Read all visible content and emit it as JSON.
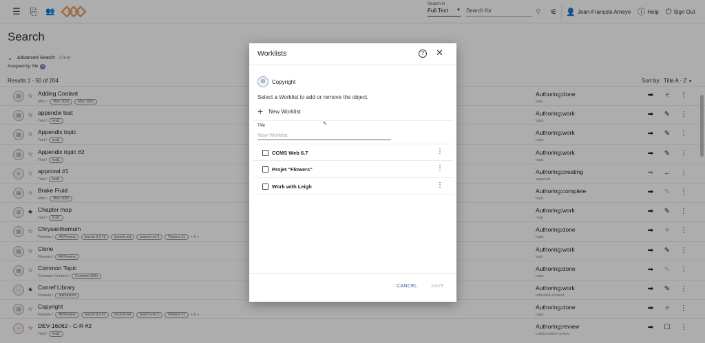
{
  "topbar": {
    "search_in_label": "Search in",
    "search_in_value": "Full Text",
    "search_placeholder": "Search for",
    "user_name": "Jean-François Ameye",
    "help_label": "Help",
    "signout_label": "Sign Out"
  },
  "page": {
    "title": "Search",
    "advanced_search": "Advanced Search",
    "clear": "Clear",
    "assigned_chip": "Assigned by: Me",
    "results": "Results 1 - 50 of 204",
    "sort_by": "Sort by:",
    "sort_value": "Title A - Z"
  },
  "rows": [
    {
      "title": "Adding Coolant",
      "sub": "Misc /",
      "tags": [
        "Misc 2019",
        "Misc 2020"
      ],
      "status": "Authoring:done",
      "type": "task",
      "a1": "➡",
      "a2": "⑂",
      "a1grey": false,
      "a2grey": false,
      "icon": "▤",
      "starred": false
    },
    {
      "title": "appendix test",
      "sub": "Test /",
      "tags": [
        "test1"
      ],
      "status": "Authoring:work",
      "type": "topic",
      "a1": "➡",
      "a2": "✎",
      "a1grey": false,
      "a2grey": false,
      "icon": "▤",
      "starred": false
    },
    {
      "title": "Appendix topic",
      "sub": "Test /",
      "tags": [
        "test1"
      ],
      "status": "Authoring:work",
      "type": "topic",
      "a1": "➡",
      "a2": "✎",
      "a1grey": false,
      "a2grey": false,
      "icon": "▤",
      "starred": false
    },
    {
      "title": "Appendix topic #2",
      "sub": "Test /",
      "tags": [
        "test1"
      ],
      "status": "Authoring:work",
      "type": "topic",
      "a1": "➡",
      "a2": "✎",
      "a1grey": false,
      "a2grey": false,
      "icon": "▤",
      "starred": false
    },
    {
      "title": "approval #1",
      "sub": "Test /",
      "tags": [
        "test1"
      ],
      "status": "Authoring:creating",
      "type": "approval",
      "a1": "➡",
      "a2": "←",
      "a1grey": true,
      "a2grey": false,
      "icon": "♕",
      "starred": false
    },
    {
      "title": "Brake Fluid",
      "sub": "Misc /",
      "tags": [
        "Misc 2020"
      ],
      "status": "Authoring:complete",
      "type": "topic",
      "a1": "➡",
      "a2": "✎",
      "a1grey": false,
      "a2grey": true,
      "icon": "▤",
      "starred": false
    },
    {
      "title": "Chapter map",
      "sub": "Test /",
      "tags": [
        "test1"
      ],
      "status": "Authoring:work",
      "type": "map",
      "a1": "➡",
      "a2": "✎",
      "a1grey": false,
      "a2grey": false,
      "icon": "⊞",
      "starred": true
    },
    {
      "title": "Chrysanthemum",
      "sub": "Flowers /",
      "tags": [
        "All Flowers",
        "branch 6.2 #3",
        "branch-net",
        "branch-net 2",
        "Flowers #1"
      ],
      "more": "+ 6 »",
      "status": "Authoring:done",
      "type": "topic",
      "a1": "➡",
      "a2": "⑂",
      "a1grey": false,
      "a2grey": false,
      "icon": "▤",
      "starred": false
    },
    {
      "title": "Clone",
      "sub": "Flowers /",
      "tags": [
        "All Flowers"
      ],
      "status": "Authoring:work",
      "type": "task",
      "a1": "➡",
      "a2": "✎",
      "a1grey": false,
      "a2grey": false,
      "icon": "▤",
      "starred": false
    },
    {
      "title": "Common Topic",
      "sub": "Common Content /",
      "tags": [
        "Common 2020"
      ],
      "status": "Authoring:done",
      "type": "topic",
      "a1": "➡",
      "a2": "✎",
      "a1grey": false,
      "a2grey": true,
      "icon": "▤",
      "starred": false
    },
    {
      "title": "Conref Library",
      "sub": "Flowers /",
      "tags": [
        "test-branch"
      ],
      "status": "Authoring:work",
      "type": "referable-content",
      "a1": "➡",
      "a2": "✎",
      "a1grey": false,
      "a2grey": false,
      "icon": "⋯",
      "starred": true
    },
    {
      "title": "Copyright",
      "sub": "Flowers /",
      "tags": [
        "All Flowers",
        "branch 6.2 #3",
        "branch-net",
        "branch-net 2",
        "Flowers #1"
      ],
      "more": "+ 6 »",
      "status": "Authoring:done",
      "type": "topic",
      "a1": "➡",
      "a2": "⑂",
      "a1grey": false,
      "a2grey": false,
      "icon": "▤",
      "starred": false
    },
    {
      "title": "DEV-16062 - C-R #2",
      "sub": "Test /",
      "tags": [
        "test1"
      ],
      "status": "Authoring:review",
      "type": "collaborative-review",
      "a1": "➡",
      "a2": "☐",
      "a1grey": false,
      "a2grey": false,
      "icon": "◔",
      "starred": false
    }
  ],
  "dialog": {
    "title": "Worklists",
    "object_name": "Copyright",
    "instruction": "Select a Worklist to add or remove the object.",
    "new_worklist": "New Worklist",
    "field_label": "Title",
    "field_placeholder": "New Worklist",
    "worklists": [
      "CCMS Web 6.7",
      "Projet \"Flowers\"",
      "Work with Leigh"
    ],
    "cancel": "CANCEL",
    "save": "SAVE"
  }
}
